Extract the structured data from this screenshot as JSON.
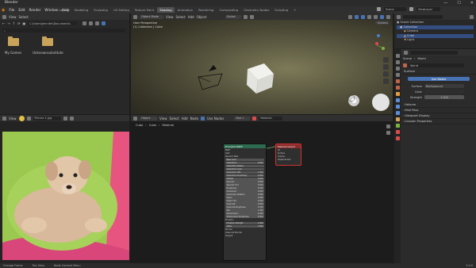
{
  "app": {
    "title": "Blender",
    "window_buttons": [
      "—",
      "☐",
      "✕"
    ]
  },
  "menu": [
    "File",
    "Edit",
    "Render",
    "Window",
    "Help"
  ],
  "workspace_tabs": [
    "Layout",
    "Modeling",
    "Sculpting",
    "UV Editing",
    "Texture Paint",
    "Shading",
    "Animation",
    "Rendering",
    "Compositing",
    "Geometry Nodes",
    "Scripting",
    "+"
  ],
  "active_tab": "Shading",
  "top_right": {
    "scene": "Scene",
    "view_layer": "ViewLayer"
  },
  "file_browser": {
    "menu": [
      "View",
      "Select"
    ],
    "path": "C:\\Users\\Jennifer\\Documents\\",
    "folders": [
      "My Games",
      "Unknownsubstitute"
    ]
  },
  "viewport": {
    "mode": "Object Mode",
    "menu": [
      "View",
      "Select",
      "Add",
      "Object"
    ],
    "transform": "Global",
    "info_line1": "User Perspective",
    "info_line2": "(1) Collection | Cube",
    "options": "Options"
  },
  "outliner": {
    "root": "Scene Collection",
    "collection": "Collection",
    "items": [
      "Camera",
      "Cube",
      "Light"
    ]
  },
  "properties": {
    "tabs": [
      "Scene",
      "World"
    ],
    "world_name": "World",
    "surface_header": "Surface",
    "use_nodes": "Use Nodes",
    "surface_label": "Surface",
    "surface_value": "Background",
    "color_label": "Color",
    "strength_label": "Strength",
    "strength_value": "1.000",
    "sections": [
      "Volume",
      "Mist Pass",
      "Viewport Display",
      "Custom Properties"
    ]
  },
  "image_editor": {
    "menu": [
      "View"
    ],
    "image_name": "Picture 1.jpg"
  },
  "node_editor": {
    "mode": "Object",
    "menu": [
      "View",
      "Select",
      "Add",
      "Node"
    ],
    "use_nodes": "Use Nodes",
    "slot": "Slot 1",
    "material": "Material",
    "breadcrumb": [
      "Cube",
      "Cube",
      "Material"
    ],
    "bsdf_title": "Principled BSDF",
    "bsdf_rows": [
      {
        "label": "BSDF",
        "value": ""
      },
      {
        "label": "GGX",
        "value": ""
      },
      {
        "label": "Random Walk",
        "value": ""
      },
      {
        "label": "Base Color",
        "value": ""
      },
      {
        "label": "Subsurface",
        "value": "0.000"
      },
      {
        "label": "Subsurface Radius",
        "value": ""
      },
      {
        "label": "Subsurface Color",
        "value": ""
      },
      {
        "label": "Subsurface IOR",
        "value": "1.400"
      },
      {
        "label": "Subsurface Anisotropy",
        "value": "0.000"
      },
      {
        "label": "Metallic",
        "value": "0.000"
      },
      {
        "label": "Specular",
        "value": "0.500"
      },
      {
        "label": "Specular Tint",
        "value": "0.000"
      },
      {
        "label": "Roughness",
        "value": "0.500"
      },
      {
        "label": "Anisotropic",
        "value": "0.000"
      },
      {
        "label": "Anisotropic Rotation",
        "value": "0.000"
      },
      {
        "label": "Sheen",
        "value": "0.000"
      },
      {
        "label": "Sheen Tint",
        "value": "0.500"
      },
      {
        "label": "Clearcoat",
        "value": "0.000"
      },
      {
        "label": "Clearcoat Roughness",
        "value": "0.030"
      },
      {
        "label": "IOR",
        "value": "1.450"
      },
      {
        "label": "Transmission",
        "value": "0.000"
      },
      {
        "label": "Transmission Roughness",
        "value": "0.000"
      },
      {
        "label": "Emission",
        "value": ""
      },
      {
        "label": "Emission Strength",
        "value": "1.000"
      },
      {
        "label": "Alpha",
        "value": "1.000"
      },
      {
        "label": "Normal",
        "value": ""
      },
      {
        "label": "Clearcoat Normal",
        "value": ""
      },
      {
        "label": "Tangent",
        "value": ""
      }
    ],
    "output_title": "Material Output",
    "output_target": "All",
    "output_rows": [
      "Surface",
      "Volume",
      "Displacement"
    ]
  },
  "statusbar": [
    "Change Frame",
    "Pan View",
    "Node Context Menu"
  ],
  "version": "3.0.0",
  "colors": {
    "accent_blue": "#4772b3",
    "bsdf_header": "#2d6a4f",
    "output_header": "#8a2b2b"
  }
}
